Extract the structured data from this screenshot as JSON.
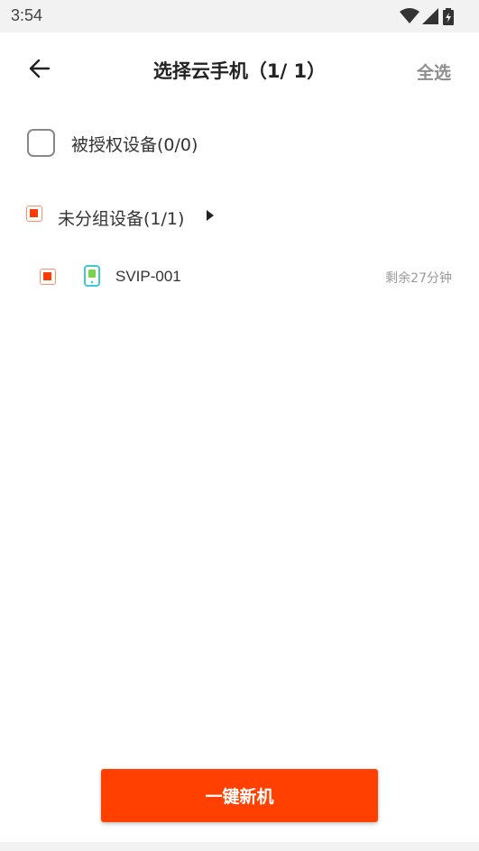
{
  "status_bar": {
    "time": "3:54",
    "icons": [
      "wifi-icon",
      "signal-icon",
      "battery-charging-icon"
    ]
  },
  "header": {
    "back_icon": "arrow-left-icon",
    "title": "选择云手机（1/ 1）",
    "select_all_label": "全选"
  },
  "authorized_group": {
    "label": "被授权设备(0/0)",
    "checked": false
  },
  "ungrouped_group": {
    "label": "未分组设备(1/1)",
    "checked": true,
    "expand_icon": "triangle-right-icon",
    "devices": [
      {
        "name": "SVIP-001",
        "remaining": "剩余27分钟",
        "checked": true,
        "icon": "phone-icon"
      }
    ]
  },
  "footer": {
    "new_machine_label": "一键新机"
  },
  "colors": {
    "accent": "#ff4000",
    "checkbox_fill": "#ff3a00",
    "device_icon": "#3fc9d6",
    "device_icon_screen": "#7cd34a",
    "secondary_text": "#999999"
  }
}
